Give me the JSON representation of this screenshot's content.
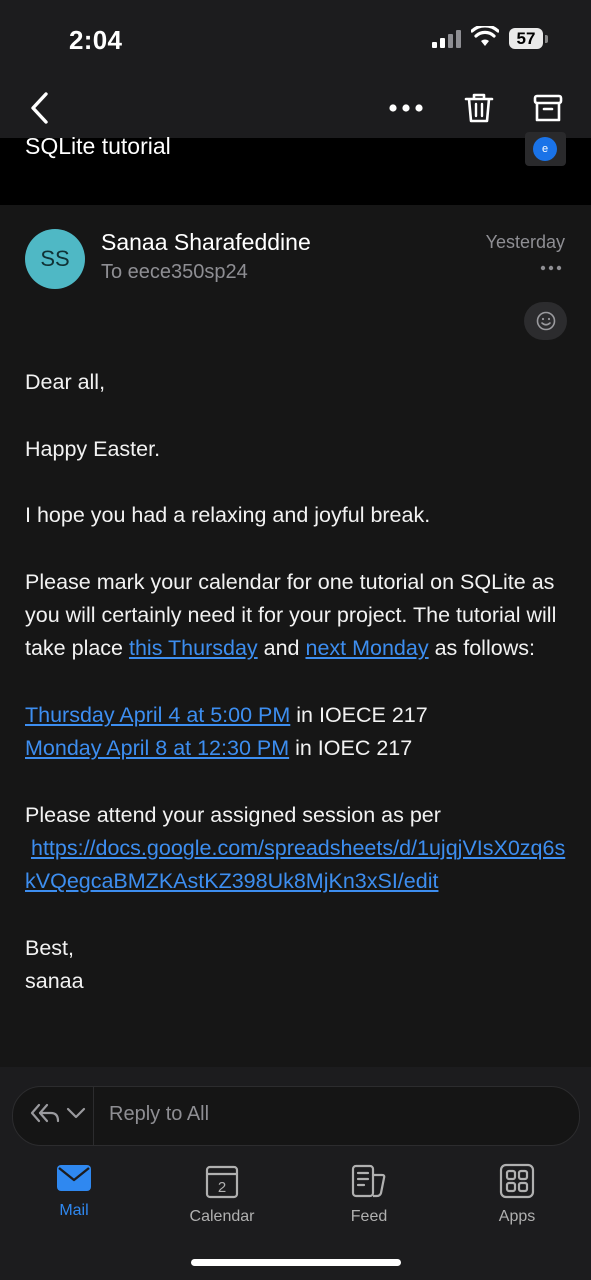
{
  "status": {
    "time": "2:04",
    "battery": "57"
  },
  "nav": {
    "back_icon": "chevron-left-icon",
    "more_icon": "more-horizontal-icon",
    "delete_icon": "trash-icon",
    "archive_icon": "archive-icon"
  },
  "email": {
    "subject": "SQLite tutorial",
    "thumb_letter": "e",
    "avatar_initials": "SS",
    "sender": "Sanaa Sharafeddine",
    "to": "To eece350sp24",
    "date": "Yesterday",
    "body": {
      "greeting": "Dear all,",
      "p1": "Happy Easter.",
      "p2": "I hope you had a relaxing and joyful break.",
      "p3_a": "Please mark your calendar for one tutorial on SQLite as you will certainly need it for your project. The tutorial will take place ",
      "p3_link1": "this Thursday",
      "p3_b": " and ",
      "p3_link2": "next Monday",
      "p3_c": " as follows:",
      "s1_link": "Thursday April 4 at 5:00 PM",
      "s1_rest": " in IOECE 217",
      "s2_link": "Monday April 8 at 12:30 PM",
      "s2_rest": " in IOEC 217",
      "p4": "Please attend your assigned session as per",
      "url": "https://docs.google.com/spreadsheets/d/1ujqjVIsX0zq6skVQegcaBMZKAstKZ398Uk8MjKn3xSI/edit",
      "closing": "Best,",
      "signature": "sanaa"
    }
  },
  "reply": {
    "placeholder": "Reply to All"
  },
  "tabs": [
    {
      "label": "Mail",
      "icon": "mail-icon",
      "active": true
    },
    {
      "label": "Calendar",
      "icon": "calendar-icon",
      "badge": "2"
    },
    {
      "label": "Feed",
      "icon": "feed-icon"
    },
    {
      "label": "Apps",
      "icon": "apps-icon"
    }
  ],
  "colors": {
    "accent": "#2f88f0",
    "link": "#3d8ef0",
    "avatar": "#4fb8c5",
    "background": "#161616"
  }
}
